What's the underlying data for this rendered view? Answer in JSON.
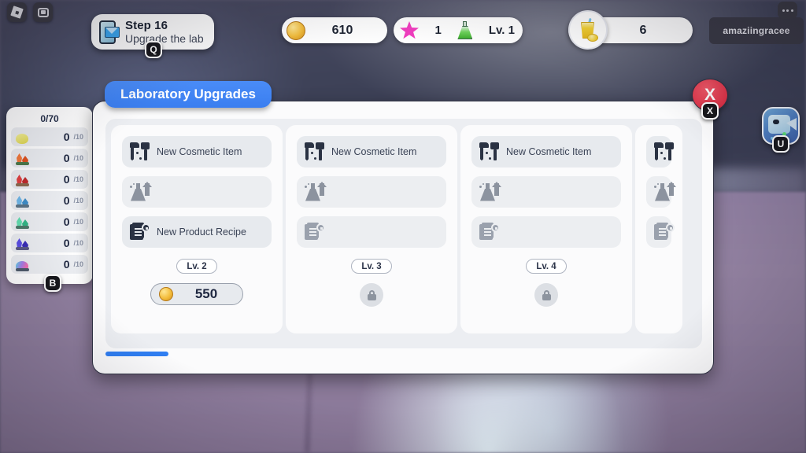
{
  "window": {
    "topleft_icons": [
      {
        "name": "roblox-logo-icon",
        "label": "Roblox"
      },
      {
        "name": "screenshot-icon",
        "label": "Capture"
      }
    ],
    "menu_dots": "…"
  },
  "quest": {
    "icon": "phone-mail-icon",
    "title": "Step 16",
    "subtitle": "Upgrade the lab",
    "keybind": "Q"
  },
  "hud": {
    "coins": {
      "icon": "coin-icon",
      "value": "610"
    },
    "stars": {
      "icon": "star-icon",
      "value": "1"
    },
    "lab": {
      "icon": "flask-icon",
      "value": "Lv. 1"
    },
    "juice": {
      "icon": "juice-icon",
      "value": "6"
    },
    "username": "amaziingracee"
  },
  "inventory": {
    "count_label": "0/70",
    "keybind": "B",
    "rows": [
      {
        "icon": "lemon-icon",
        "color": "#eae463",
        "amount": "0",
        "max": "/10"
      },
      {
        "icon": "orange-coral-icon",
        "color": "#f26a2c",
        "amount": "0",
        "max": "/10"
      },
      {
        "icon": "red-crystal-icon",
        "color": "#e03b3b",
        "amount": "0",
        "max": "/10"
      },
      {
        "icon": "blue-crystal-icon",
        "color": "#5aa8e8",
        "amount": "0",
        "max": "/10"
      },
      {
        "icon": "green-crystal-icon",
        "color": "#4fd3a0",
        "amount": "0",
        "max": "/10"
      },
      {
        "icon": "purple-crystal-icon",
        "color": "#4b3fd6",
        "amount": "0",
        "max": "/10"
      },
      {
        "icon": "rainbow-orb-icon",
        "color": "#9be0d8",
        "amount": "0",
        "max": "/10"
      }
    ]
  },
  "dialog": {
    "title": "Laboratory Upgrades",
    "close_label": "X",
    "close_keybind": "X",
    "scrollbar": {
      "position": "left"
    },
    "cards": [
      {
        "features": [
          {
            "icon": "cosmetic-tools-icon",
            "label": "New Cosmetic Item",
            "locked": false
          },
          {
            "icon": "flask-upgrade-icon",
            "label": "",
            "locked": true
          },
          {
            "icon": "recipe-lock-icon",
            "label": "New Product Recipe",
            "locked": false
          }
        ],
        "level": "Lv. 2",
        "action": "buy",
        "price": "550",
        "price_icon": "coin-icon"
      },
      {
        "features": [
          {
            "icon": "cosmetic-tools-icon",
            "label": "New Cosmetic Item",
            "locked": false
          },
          {
            "icon": "flask-upgrade-icon",
            "label": "",
            "locked": true
          },
          {
            "icon": "recipe-lock-icon",
            "label": "",
            "locked": true
          }
        ],
        "level": "Lv. 3",
        "action": "locked",
        "price": "",
        "price_icon": "lock-icon"
      },
      {
        "features": [
          {
            "icon": "cosmetic-tools-icon",
            "label": "New Cosmetic Item",
            "locked": false
          },
          {
            "icon": "flask-upgrade-icon",
            "label": "",
            "locked": true
          },
          {
            "icon": "recipe-lock-icon",
            "label": "",
            "locked": true
          }
        ],
        "level": "Lv. 4",
        "action": "locked",
        "price": "",
        "price_icon": "lock-icon"
      },
      {
        "features": [
          {
            "icon": "cosmetic-tools-icon",
            "label": "",
            "locked": false
          },
          {
            "icon": "flask-upgrade-icon",
            "label": "",
            "locked": true
          },
          {
            "icon": "recipe-lock-icon",
            "label": "",
            "locked": true
          }
        ],
        "level": "",
        "action": "locked",
        "price": "",
        "price_icon": "lock-icon"
      }
    ]
  },
  "avatar": {
    "icon": "character-avatar-icon",
    "keybind": "U"
  },
  "colors": {
    "accent_blue": "#3a7ef0",
    "close_red": "#df3348",
    "panel_bg": "#fbfbfc",
    "scroll_bg": "#eceef2"
  }
}
